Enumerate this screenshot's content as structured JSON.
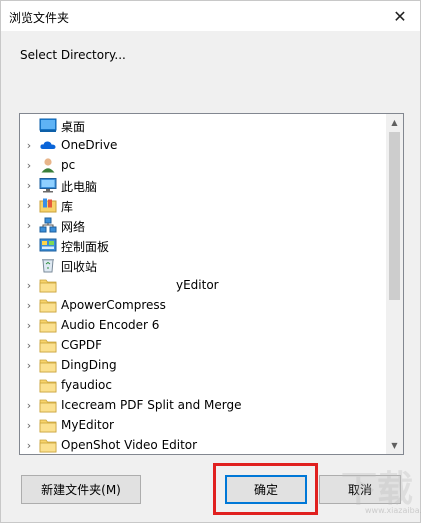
{
  "window": {
    "title": "浏览文件夹",
    "close_glyph": "✕"
  },
  "prompt": "Select Directory...",
  "tree": {
    "items": [
      {
        "label": "桌面",
        "icon": "desktop-icon",
        "chevron": ""
      },
      {
        "label": "OneDrive",
        "icon": "onedrive-cloud-icon",
        "chevron": "›"
      },
      {
        "label": "pc",
        "icon": "user-icon",
        "chevron": "›"
      },
      {
        "label": "此电脑",
        "icon": "computer-icon",
        "chevron": "›"
      },
      {
        "label": "库",
        "icon": "library-icon",
        "chevron": "›"
      },
      {
        "label": "网络",
        "icon": "network-icon",
        "chevron": "›"
      },
      {
        "label": "控制面板",
        "icon": "control-panel-icon",
        "chevron": "›"
      },
      {
        "label": "回收站",
        "icon": "recycle-bin-icon",
        "chevron": ""
      },
      {
        "label": "yEditor",
        "icon": "folder-icon",
        "chevron": "›",
        "redacted": true
      },
      {
        "label": "ApowerCompress",
        "icon": "folder-icon",
        "chevron": "›"
      },
      {
        "label": "Audio Encoder 6",
        "icon": "folder-icon",
        "chevron": "›"
      },
      {
        "label": "CGPDF",
        "icon": "folder-icon",
        "chevron": "›"
      },
      {
        "label": "DingDing",
        "icon": "folder-icon",
        "chevron": "›"
      },
      {
        "label": "fyaudioc",
        "icon": "folder-icon",
        "chevron": ""
      },
      {
        "label": "Icecream PDF Split and Merge",
        "icon": "folder-icon",
        "chevron": "›"
      },
      {
        "label": "MyEditor",
        "icon": "folder-icon",
        "chevron": "›"
      },
      {
        "label": "OpenShot Video Editor",
        "icon": "folder-icon",
        "chevron": "›"
      }
    ]
  },
  "buttons": {
    "new_folder": "新建文件夹(M)",
    "ok": "确定",
    "cancel": "取消"
  },
  "watermark": {
    "main": "下载",
    "sub": "www.xiazaiba.com"
  },
  "colors": {
    "folder": "#f7d36b",
    "highlight": "#e0201f",
    "accent": "#0078d7"
  }
}
